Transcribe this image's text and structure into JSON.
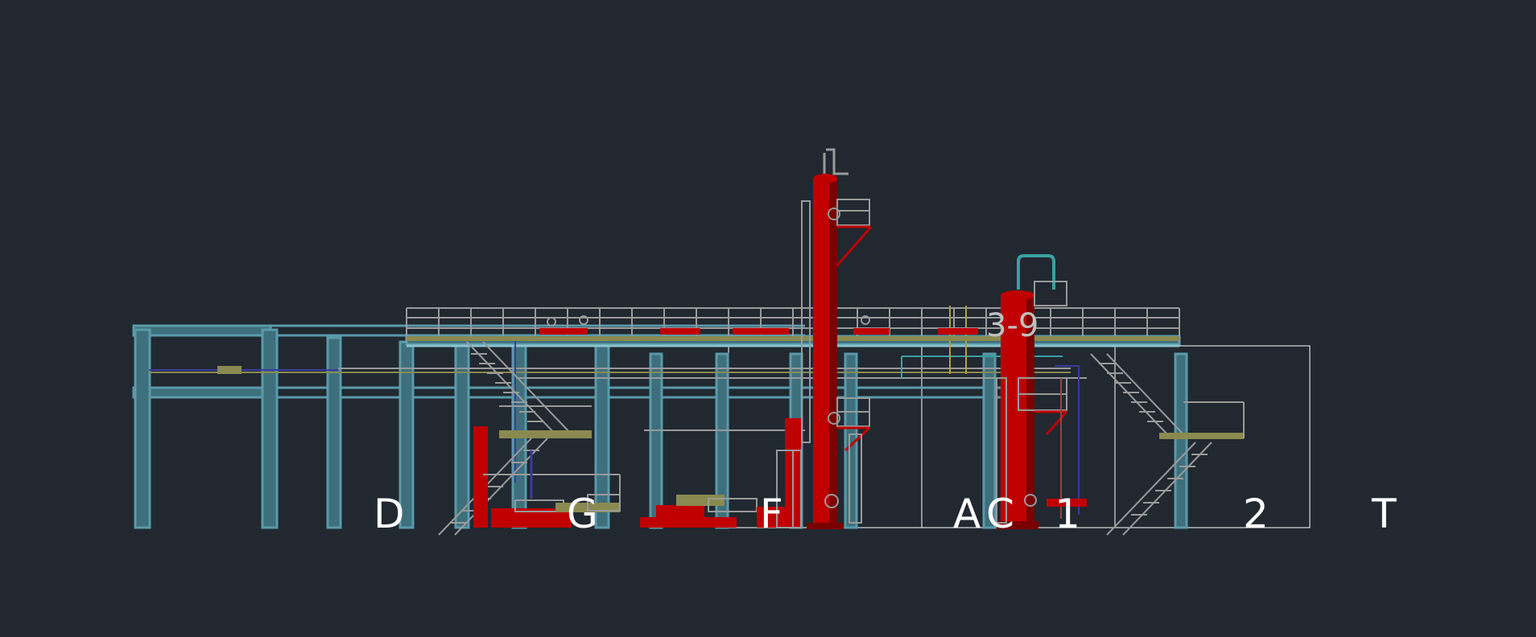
{
  "drawing": {
    "background": "#212830",
    "colors": {
      "structure": "#5a9aaa",
      "structure_light": "#8cc4d0",
      "railing": "#9a9a9a",
      "vessel": "#c00000",
      "vessel_dark": "#7a0000",
      "pipe_olive": "#8a8a50",
      "pipe_blue": "#3a3aa0",
      "pipe_teal": "#3aa0a0",
      "viewport_frame": "#ffffff"
    },
    "labels": [
      "D",
      "G",
      "F",
      "A",
      "C",
      "1",
      "2",
      "T"
    ],
    "overlay_text": "3-9"
  }
}
